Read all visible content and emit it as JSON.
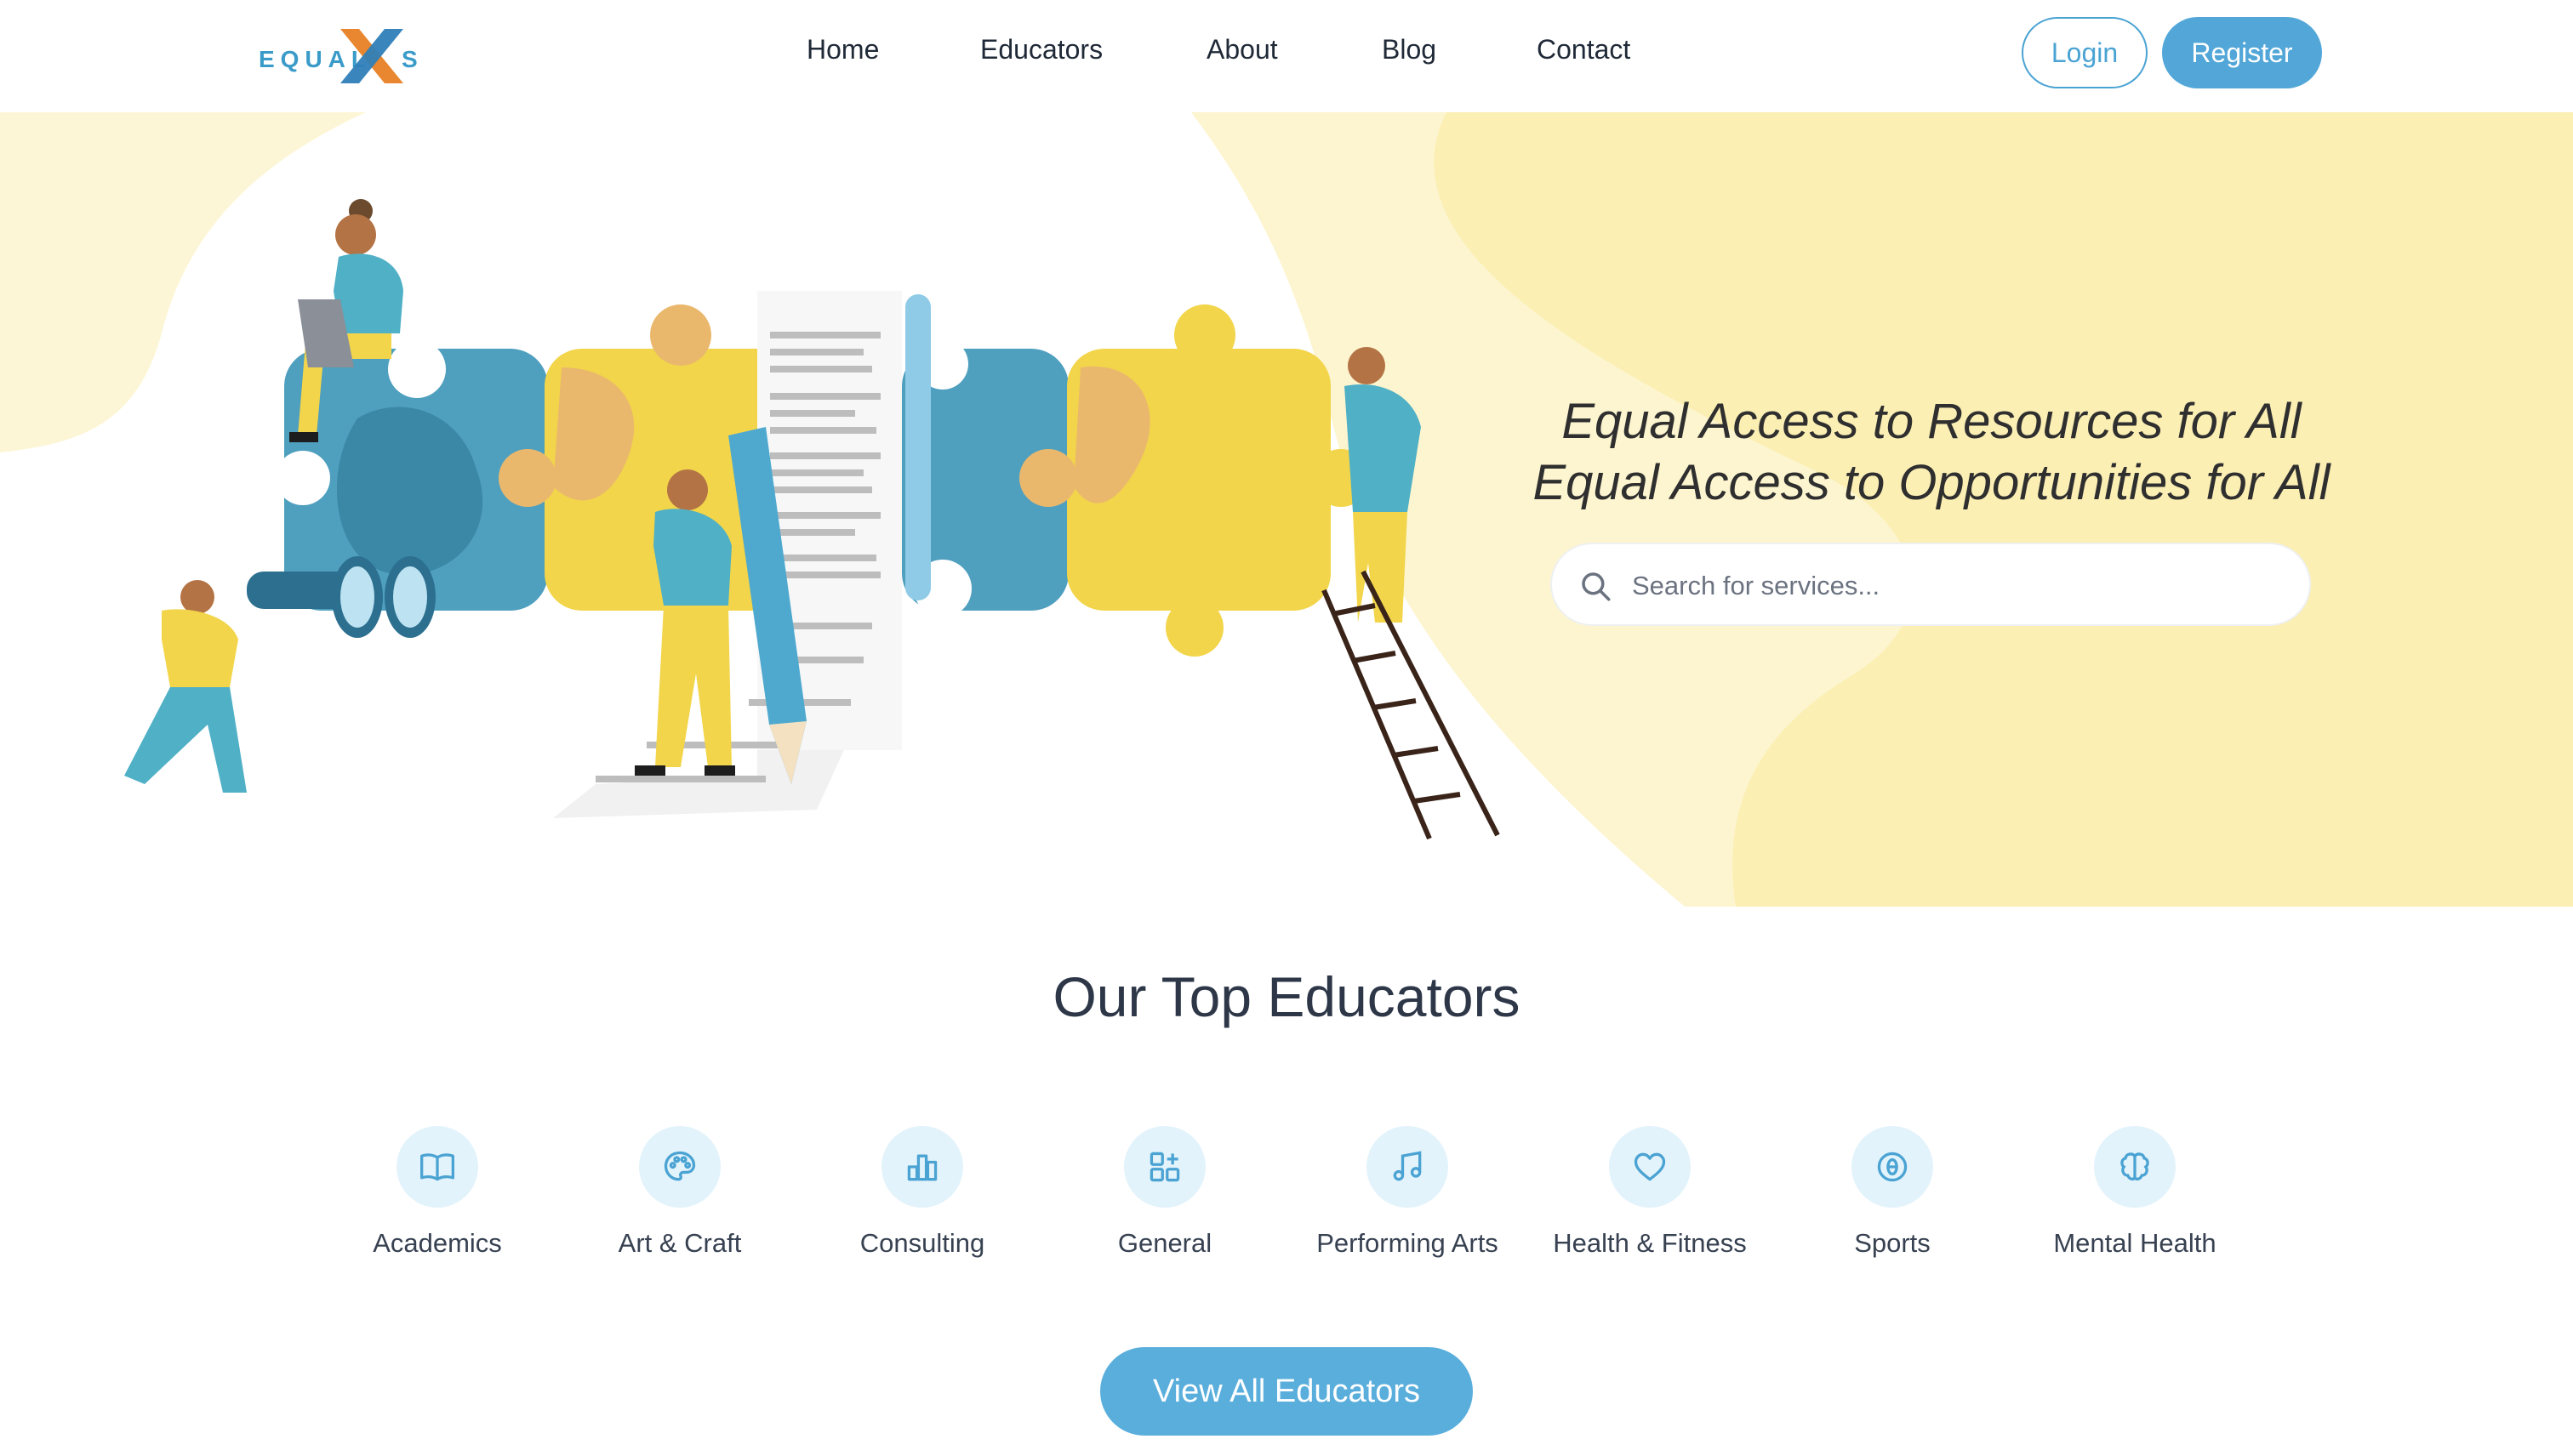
{
  "brand": {
    "logo_text": "EQUAL",
    "logo_suffix": "S",
    "accent": "#52a7d8",
    "logo_x_colors": [
      "#e8872f",
      "#2f7fb8"
    ]
  },
  "nav": {
    "items": [
      {
        "label": "Home"
      },
      {
        "label": "Educators"
      },
      {
        "label": "About"
      },
      {
        "label": "Blog"
      },
      {
        "label": "Contact"
      }
    ],
    "login_label": "Login",
    "register_label": "Register"
  },
  "hero": {
    "tagline_1": "Equal Access to Resources for All",
    "tagline_2": "Equal Access to Opportunities for All",
    "search": {
      "placeholder": "Search for services...",
      "value": "",
      "icon": "search-icon"
    },
    "background_color": "#fbefb4"
  },
  "educators": {
    "title": "Our Top Educators",
    "categories": [
      {
        "label": "Academics",
        "icon": "book-icon"
      },
      {
        "label": "Art & Craft",
        "icon": "palette-icon"
      },
      {
        "label": "Consulting",
        "icon": "bar-chart-icon"
      },
      {
        "label": "General",
        "icon": "grid-plus-icon"
      },
      {
        "label": "Performing Arts",
        "icon": "music-note-icon"
      },
      {
        "label": "Health & Fitness",
        "icon": "heart-icon"
      },
      {
        "label": "Sports",
        "icon": "ball-icon"
      },
      {
        "label": "Mental Health",
        "icon": "brain-icon"
      }
    ],
    "view_all_label": "View All Educators"
  }
}
